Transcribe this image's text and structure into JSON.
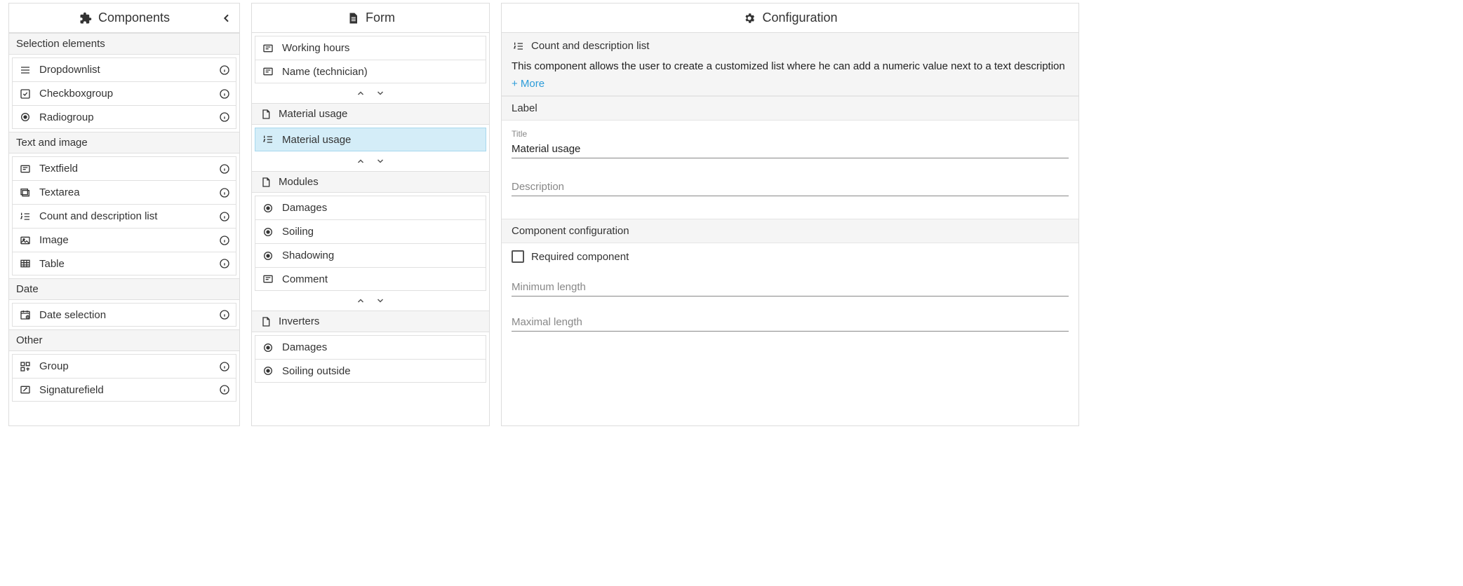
{
  "panels": {
    "components": {
      "title": "Components"
    },
    "form": {
      "title": "Form"
    },
    "config": {
      "title": "Configuration"
    }
  },
  "components": {
    "group_selection": "Selection elements",
    "dropdownlist": "Dropdownlist",
    "checkboxgroup": "Checkboxgroup",
    "radiogroup": "Radiogroup",
    "group_text_image": "Text and image",
    "textfield": "Textfield",
    "textarea": "Textarea",
    "countlist": "Count and description list",
    "image": "Image",
    "table": "Table",
    "group_date": "Date",
    "date_selection": "Date selection",
    "group_other": "Other",
    "group": "Group",
    "signature": "Signaturefield"
  },
  "form": {
    "working_hours": "Working hours",
    "name_technician": "Name (technician)",
    "section_material": "Material usage",
    "item_material_usage": "Material usage",
    "section_modules": "Modules",
    "damages": "Damages",
    "soiling": "Soiling",
    "shadowing": "Shadowing",
    "comment": "Comment",
    "section_inverters": "Inverters",
    "inv_damages": "Damages",
    "inv_soiling_outside": "Soiling outside"
  },
  "config": {
    "component_name": "Count and description list",
    "help_text": "This component allows the user to create a customized list where he can add a numeric value next to a text description",
    "more": "+ More",
    "section_label": "Label",
    "title_label": "Title",
    "title_value": "Material usage",
    "description_placeholder": "Description",
    "section_component_config": "Component configuration",
    "required_label": "Required component",
    "min_length_placeholder": "Minimum length",
    "max_length_placeholder": "Maximal length"
  }
}
